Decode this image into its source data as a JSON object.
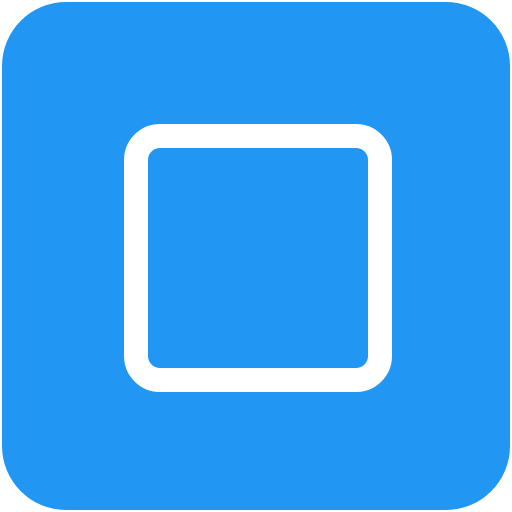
{
  "icon": {
    "name": "square-outline-icon",
    "colors": {
      "tile_background": "#2196f3",
      "outline": "#ffffff",
      "page_background": "#ffffff"
    }
  }
}
